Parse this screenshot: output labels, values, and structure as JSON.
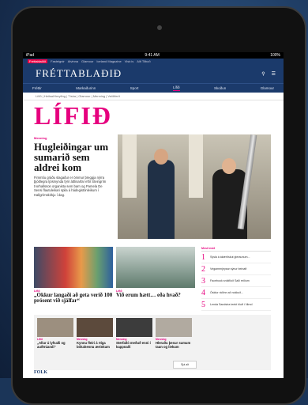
{
  "statusbar": {
    "device": "iPad",
    "time": "9:41 AM",
    "battery": "100%"
  },
  "topnav": {
    "items": [
      "Fréttablaðið",
      "Fasteignir",
      "Atvinna",
      "Glamour",
      "Iceland Magazine",
      "Visir.is",
      "Allt Tilboð"
    ]
  },
  "masthead": {
    "logo": "FRÉTTABLAÐIÐ",
    "search_icon": "search-icon",
    "menu_icon": "menu-icon"
  },
  "sections": {
    "items": [
      "Fréttir",
      "Markaðurinn",
      "Sport",
      "Lífið",
      "Skoðun",
      "Glamour"
    ],
    "active": "Lífið"
  },
  "subnav": {
    "items": [
      "Lífið",
      "Heilsa/Hreyfing",
      "Tíska",
      "Glamour",
      "Menning",
      "Veiðiferð"
    ]
  },
  "section_title": "LÍFIÐ",
  "hero": {
    "kicker": "Menning",
    "title": "Hugleiðingar um sumarið sem aldrei kom",
    "body": "Fimmtíu gráðu slagaður er ömmur þreggja nýrra þjóðlegra ljósmynda fyrir áttlinarfar eftir Steingrím Þorhallsson organista sem barn og Pamela De Sensi flautuleikari spila á hádegistónleikum í Hallgrímskirkju í dag."
  },
  "cards": [
    {
      "kicker": "Lífið",
      "title": "„Okkur langaði að geta verið 100 prósent við sjálfar“"
    },
    {
      "kicker": "Lífið",
      "title": "Við erum hætt… eða hvað?"
    }
  ],
  "mostread": {
    "heading": "Mest lesið",
    "items": [
      {
        "num": "1",
        "text": "Sýsla á ákærðskut gleraunum..."
      },
      {
        "num": "2",
        "text": "Vegamenjeysar sýnur beinaft"
      },
      {
        "num": "3",
        "text": "Facebook sníkfiloð Salli reiðum"
      },
      {
        "num": "4",
        "text": "Ósldur ráðinn að nokkuð..."
      },
      {
        "num": "5",
        "text": "Lenda Sandstra teekt hlutf í Nirnd"
      }
    ]
  },
  "small_cards": [
    {
      "kicker": "Lífið",
      "title": "„Allur á lyfsalli og auðtrúandi“"
    },
    {
      "kicker": "Menning",
      "title": "Kynnu fleiri á rtíga bókahennu æeinkum"
    },
    {
      "kicker": "Menning",
      "title": "Sterfalló meðuð enni í kappnaði"
    },
    {
      "kicker": "Menning",
      "title": "Hleraðu þesur sumum taun og liekum"
    }
  ],
  "more_button": "Sjá alt",
  "footer_heading": "FOLK",
  "colors": {
    "brand_navy": "#1b3a6b",
    "accent_pink": "#e6007e"
  }
}
